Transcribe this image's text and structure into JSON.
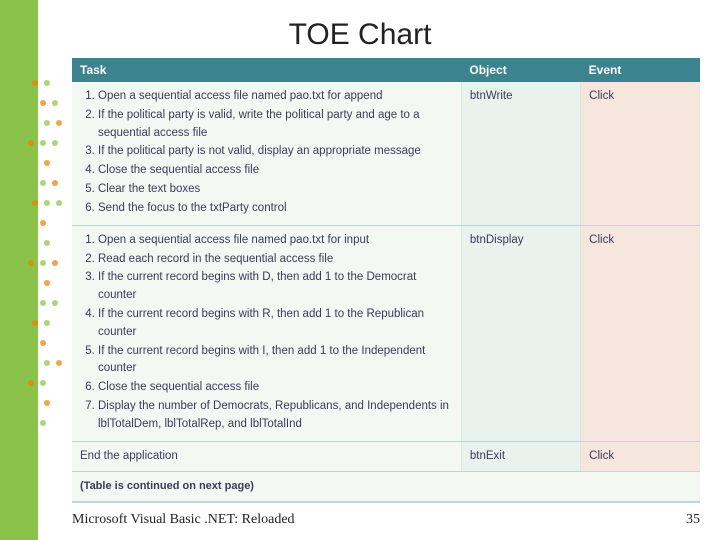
{
  "title": "TOE Chart",
  "headers": {
    "task": "Task",
    "object": "Object",
    "event": "Event"
  },
  "rows": [
    {
      "tasks": [
        "Open a sequential access file named pao.txt for append",
        "If the political party is valid, write the political party and age to a sequential access file",
        "If the political party is not valid, display an appropriate message",
        "Close the sequential access file",
        "Clear the text boxes",
        "Send the focus to the txtParty control"
      ],
      "object": "btnWrite",
      "event": "Click"
    },
    {
      "tasks": [
        "Open a sequential access file named pao.txt for input",
        "Read each record in the sequential access file",
        "If the current record begins with D, then add 1 to the Democrat counter",
        "If the current record begins with R, then add 1 to the Republican counter",
        "If the current record begins with I, then add 1 to the Independent counter",
        "Close the sequential access file",
        "Display the number of Democrats, Republicans, and Independents in lblTotalDem, lblTotalRep, and lblTotalInd"
      ],
      "object": "btnDisplay",
      "event": "Click"
    },
    {
      "tasks_plain": "End the application",
      "object": "btnExit",
      "event": "Click"
    }
  ],
  "caption": "(Table is continued on next page)",
  "footer": "Microsoft Visual Basic .NET: Reloaded",
  "page_num": "35"
}
